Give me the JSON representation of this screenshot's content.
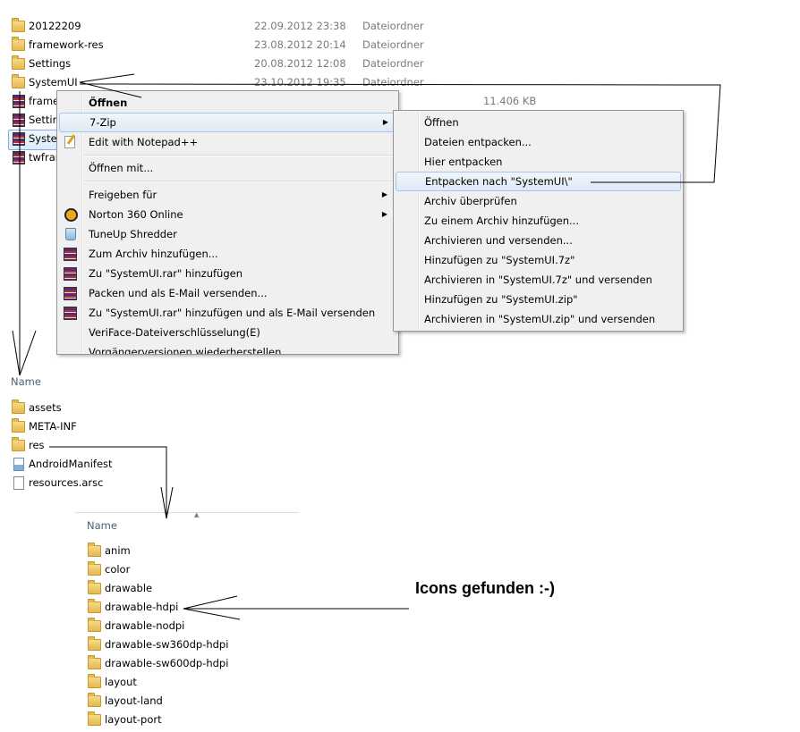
{
  "top_explorer": {
    "rows": [
      {
        "name": "20122209",
        "date": "22.09.2012 23:38",
        "type": "Dateiordner",
        "size": ""
      },
      {
        "name": "framework-res",
        "date": "23.08.2012 20:14",
        "type": "Dateiordner",
        "size": ""
      },
      {
        "name": "Settings",
        "date": "20.08.2012 12:08",
        "type": "Dateiordner",
        "size": ""
      },
      {
        "name": "SystemUI",
        "date": "23.10.2012 19:35",
        "type": "Dateiordner",
        "size": ""
      },
      {
        "name": "frame",
        "date": "",
        "type": "",
        "size": "11.406 KB"
      },
      {
        "name": "Settin",
        "date": "",
        "type": "",
        "size": ""
      },
      {
        "name": "Syster",
        "date": "",
        "type": "",
        "size": ""
      },
      {
        "name": "twfrar",
        "date": "",
        "type": "",
        "size": ""
      }
    ]
  },
  "context_menu": {
    "items": [
      {
        "label": "Öffnen",
        "bold": true
      },
      {
        "label": "7-Zip",
        "submenu": true
      },
      {
        "label": "Edit with Notepad++"
      },
      {
        "label": "Öffnen mit..."
      },
      {
        "label": "Freigeben für",
        "submenu": true
      },
      {
        "label": "Norton 360 Online",
        "submenu": true
      },
      {
        "label": "TuneUp Shredder"
      },
      {
        "label": "Zum Archiv hinzufügen..."
      },
      {
        "label": "Zu \"SystemUI.rar\" hinzufügen"
      },
      {
        "label": "Packen und als E-Mail versenden..."
      },
      {
        "label": "Zu \"SystemUI.rar\" hinzufügen und als E-Mail versenden"
      },
      {
        "label": "VeriFace-Dateiverschlüsselung(E)"
      },
      {
        "label": "Vorgängerversionen wiederherstellen"
      }
    ]
  },
  "zip_submenu": {
    "items": [
      {
        "label": "Öffnen"
      },
      {
        "label": "Dateien entpacken..."
      },
      {
        "label": "Hier entpacken"
      },
      {
        "label": "Entpacken nach \"SystemUI\\\""
      },
      {
        "label": "Archiv überprüfen"
      },
      {
        "label": "Zu einem Archiv hinzufügen..."
      },
      {
        "label": "Archivieren und versenden..."
      },
      {
        "label": "Hinzufügen zu \"SystemUI.7z\""
      },
      {
        "label": "Archivieren in \"SystemUI.7z\" und versenden"
      },
      {
        "label": "Hinzufügen zu \"SystemUI.zip\""
      },
      {
        "label": "Archivieren in \"SystemUI.zip\" und versenden"
      }
    ]
  },
  "mid_explorer": {
    "header": "Name",
    "rows": [
      {
        "name": "assets",
        "icon": "folder-icon"
      },
      {
        "name": "META-INF",
        "icon": "folder-icon"
      },
      {
        "name": "res",
        "icon": "folder-icon"
      },
      {
        "name": "AndroidManifest",
        "icon": "manifest-icon"
      },
      {
        "name": "resources.arsc",
        "icon": "file-icon"
      }
    ]
  },
  "bottom_explorer": {
    "header": "Name",
    "rows": [
      {
        "name": "anim"
      },
      {
        "name": "color"
      },
      {
        "name": "drawable"
      },
      {
        "name": "drawable-hdpi"
      },
      {
        "name": "drawable-nodpi"
      },
      {
        "name": "drawable-sw360dp-hdpi"
      },
      {
        "name": "drawable-sw600dp-hdpi"
      },
      {
        "name": "layout"
      },
      {
        "name": "layout-land"
      },
      {
        "name": "layout-port"
      }
    ]
  },
  "callout": {
    "text": "Icons gefunden :-)"
  },
  "colors": {
    "highlight_border": "#a8c4e6",
    "menu_bg": "#f0f0f0",
    "meta_text": "#7a7a7a"
  }
}
